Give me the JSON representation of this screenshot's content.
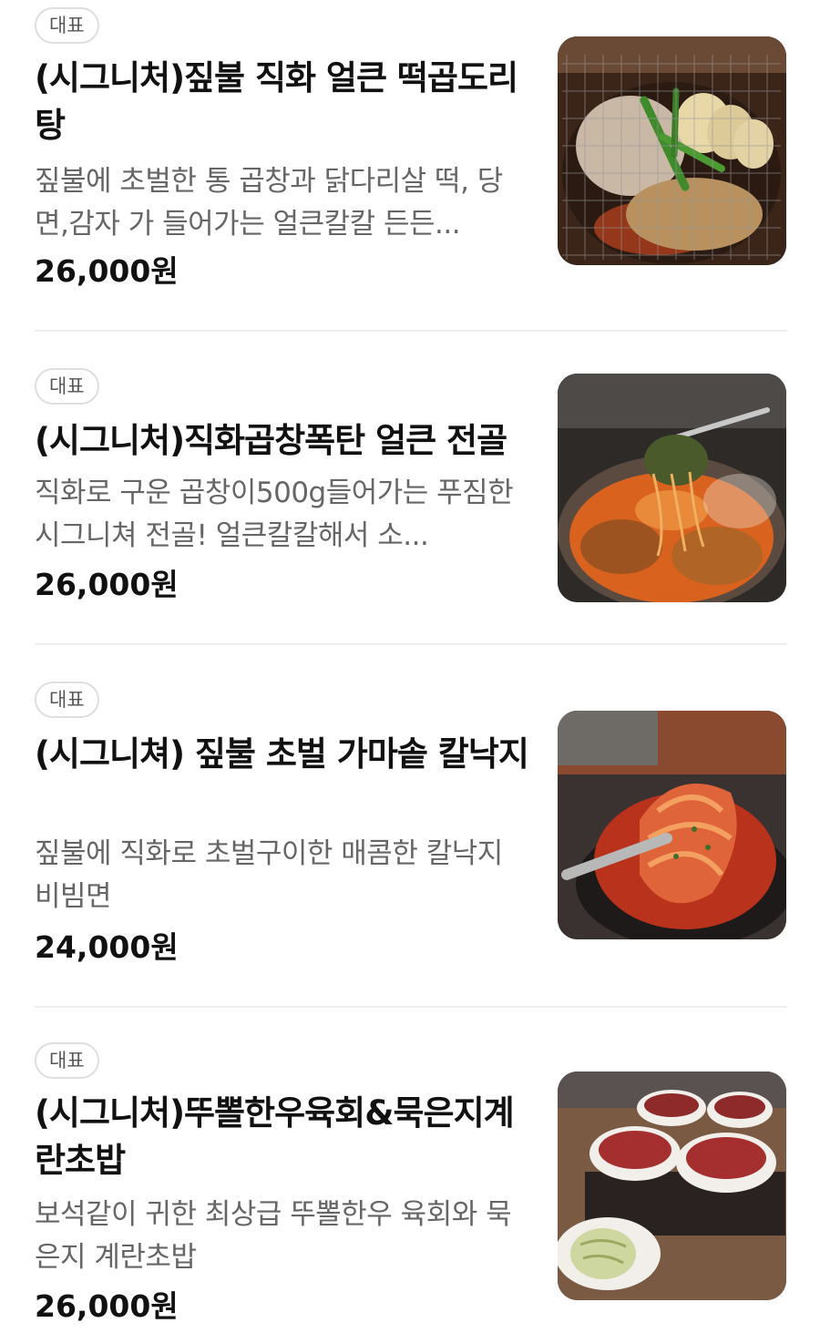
{
  "badge_label": "대표",
  "items": [
    {
      "title": "(시그니처)짚불 직화 얼큰 떡곱도리탕",
      "description": "짚불에 초벌한 통 곱창과 닭다리살 떡, 당면,감자 가 들어가는 얼큰칼칼 든든...",
      "price": "26,000원",
      "image": "grilled-gopchang-chicken-photo"
    },
    {
      "title": "(시그니처)직화곱창폭탄 얼큰 전골",
      "description": "직화로 구운 곱창이500g들어가는 푸짐한 시그니쳐 전골! 얼큰칼칼해서 소...",
      "price": "26,000원",
      "image": "gopchang-hotpot-photo"
    },
    {
      "title": "(시그니쳐) 짚불 초벌 가마솥 칼낙지",
      "description": "짚불에 직화로 초벌구이한 매콤한 칼낙지비빔면",
      "price": "24,000원",
      "image": "spicy-octopus-noodles-photo"
    },
    {
      "title": "(시그니처)뚜뽈한우육회&묵은지계란초밥",
      "description": "보석같이 귀한 최상급 뚜뽈한우 육회와 묵은지 계란초밥",
      "price": "26,000원",
      "image": "beef-tartare-kimchi-sushi-photo"
    }
  ]
}
